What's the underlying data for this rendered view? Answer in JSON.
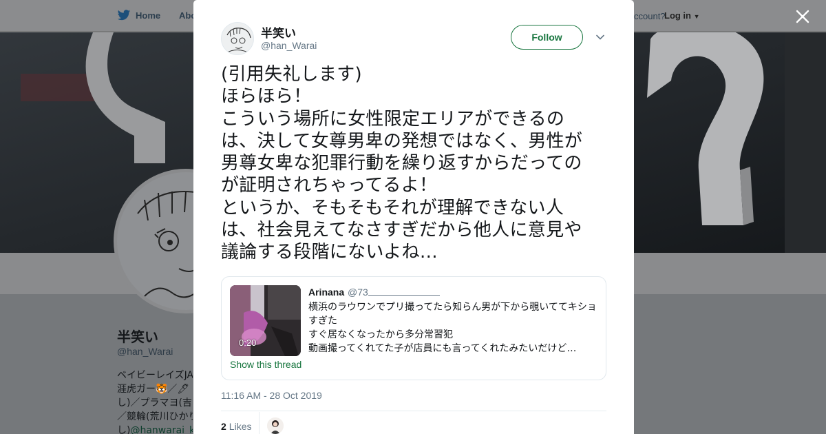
{
  "background": {
    "nav": {
      "home_label": "Home",
      "about_label": "Abo",
      "account_text": "ccount?",
      "login_label": "Log in"
    },
    "profile": {
      "name": "半笑い",
      "handle": "@han_Warai",
      "bio_lines": [
        "ベイビーレイズJA",
        "涯虎ガー🐯／🖊",
        "し)／プラマヨ(吉",
        "／競輪(荒川ひかり",
        "し)"
      ],
      "bio_link": "@hanwarai_ke"
    }
  },
  "modal": {
    "author": {
      "name": "半笑い",
      "handle": "@han_Warai"
    },
    "follow_label": "Follow",
    "tweet_lines": [
      "(引用失礼します)",
      "ほらほら！",
      "こういう場所に女性限定エリアができるの",
      "は、決して女尊男卑の発想ではなく、男性が",
      "男尊女卑な犯罪行動を繰り返すからだっての",
      "が証明されちゃってるよ！",
      "というか、そもそもそれが理解できない人",
      "は、社会見えてなさすぎだから他人に意見や",
      "議論する段階にないよね…"
    ],
    "quote": {
      "name": "Arinana",
      "handle": "@73",
      "text_lines": [
        "横浜のラウワンでプリ撮ってたら知らん男が下から覗いててキショ",
        "すぎた",
        "すぐ居なくなったから多分常習犯",
        "動画撮ってくれてた子が店員にも言ってくれたみたいだけど…"
      ],
      "video_duration": "0:20",
      "show_thread": "Show this thread"
    },
    "timestamp": "11:16 AM - 28 Oct 2019",
    "likes_count": "2",
    "likes_label": "Likes"
  },
  "colors": {
    "accent": "#17753e",
    "text": "#14171a",
    "muted": "#657786",
    "overlay": "#7d7f82"
  }
}
